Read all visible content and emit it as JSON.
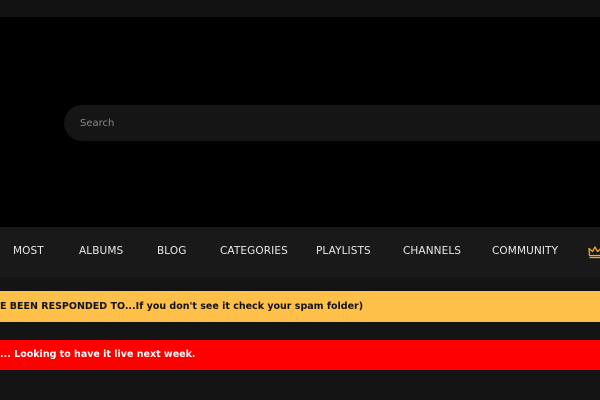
{
  "search": {
    "placeholder": "Search"
  },
  "nav": {
    "items": [
      {
        "label": "MOST"
      },
      {
        "label": "ALBUMS"
      },
      {
        "label": "BLOG"
      },
      {
        "label": "CATEGORIES"
      },
      {
        "label": "PLAYLISTS"
      },
      {
        "label": "CHANNELS"
      },
      {
        "label": "COMMUNITY"
      }
    ],
    "crown_icon": "crown-icon",
    "crown_color": "#f5a623"
  },
  "alerts": {
    "yellow_text": "E BEEN RESPONDED TO...If you don't see it check your spam folder)",
    "yellow_color": "#ffc04a",
    "red_text": "... Looking to have it live next week.",
    "red_color": "#ff0000"
  }
}
